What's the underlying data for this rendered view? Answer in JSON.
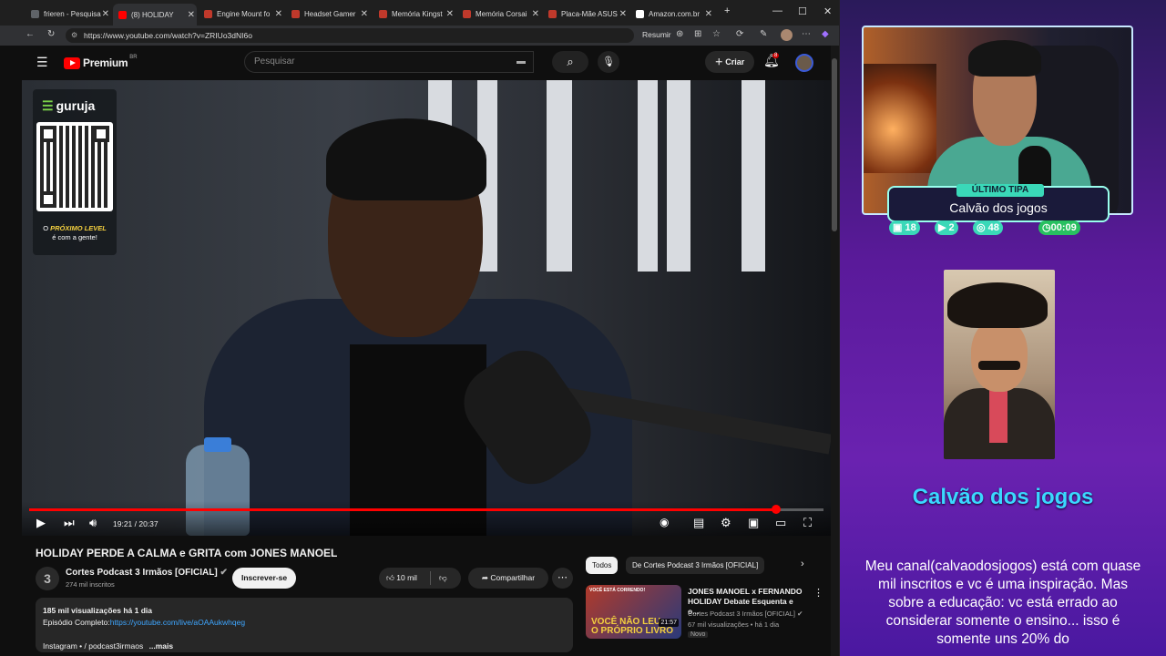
{
  "browser": {
    "tabs": [
      {
        "label": "frieren - Pesquisa",
        "color": "#5f6368"
      },
      {
        "label": "(8) HOLIDAY",
        "color": "#ff0000"
      },
      {
        "label": "Engine Mount fo",
        "color": "#c0392b"
      },
      {
        "label": "Headset Gamer",
        "color": "#c0392b"
      },
      {
        "label": "Memória Kingst",
        "color": "#c0392b"
      },
      {
        "label": "Memória Corsai",
        "color": "#c0392b"
      },
      {
        "label": "Placa-Mãe ASUS",
        "color": "#c0392b"
      },
      {
        "label": "Amazon.com.br",
        "color": "#ffffff"
      }
    ],
    "url": "https://www.youtube.com/watch?v=ZRIUo3dNI6o",
    "resumir": "Resumir"
  },
  "youtube": {
    "logo": "Premium",
    "region": "BR",
    "search_placeholder": "Pesquisar",
    "create_label": "Criar",
    "notifications": "8",
    "video": {
      "sponsor": "guruja",
      "sponsor_tag_a": "O",
      "sponsor_tag_b": "PRÓXIMO LEVEL",
      "sponsor_tag_c": "é com a gente!",
      "time": "19:21 / 20:37",
      "progress": 0.94
    },
    "title": "HOLIDAY PERDE A CALMA e GRITA com JONES MANOEL",
    "channel": {
      "name": "Cortes Podcast 3 Irmãos [OFICIAL]",
      "subs": "274 mil inscritos",
      "initial": "3"
    },
    "subscribe": "Inscrever-se",
    "likes": "10 mil",
    "share": "Compartilhar",
    "description": {
      "views": "185 mil visualizações  há 1 dia",
      "episode_label": "Episódio Completo:",
      "episode_link": "https://youtube.com/live/aOAAukwhqeg",
      "instagram": "Instagram • ",
      "instagram_handle": "/ podcast3irmaos",
      "more": "...mais"
    },
    "chips": [
      "Todos",
      "De Cortes Podcast 3 Irmãos [OFICIAL]"
    ],
    "recommended": {
      "thumb_top": "VOCÊ ESTÁ CORRENDO!",
      "thumb_main_a": "VOCÊ NÃO LEU",
      "thumb_main_b": "O PRÓPRIO LIVRO",
      "duration": "21:57",
      "title": "JONES MANOEL x FERNANDO HOLIDAY Debate Esquenta e o...",
      "channel": "Cortes Podcast 3 Irmãos [OFICIAL]",
      "meta": "67 mil visualizações • há 1 dia",
      "badge": "Novo"
    }
  },
  "stream": {
    "last_tip_label": "ÚLTIMO TIPA",
    "last_tip_name": "Calvão dos jogos",
    "stats": [
      {
        "icon": "twitch-icon",
        "value": "18"
      },
      {
        "icon": "youtube-icon",
        "value": "2"
      },
      {
        "icon": "kick-icon",
        "value": "48"
      },
      {
        "icon": "clock-icon",
        "value": "00:09"
      }
    ],
    "donor": "Calvão dos jogos",
    "message": "Meu canal(calvaodosjogos) está com quase mil inscritos e vc é uma inspiração. Mas sobre a educação: vc está errado ao considerar somente o ensino... isso é somente uns 20% do"
  }
}
